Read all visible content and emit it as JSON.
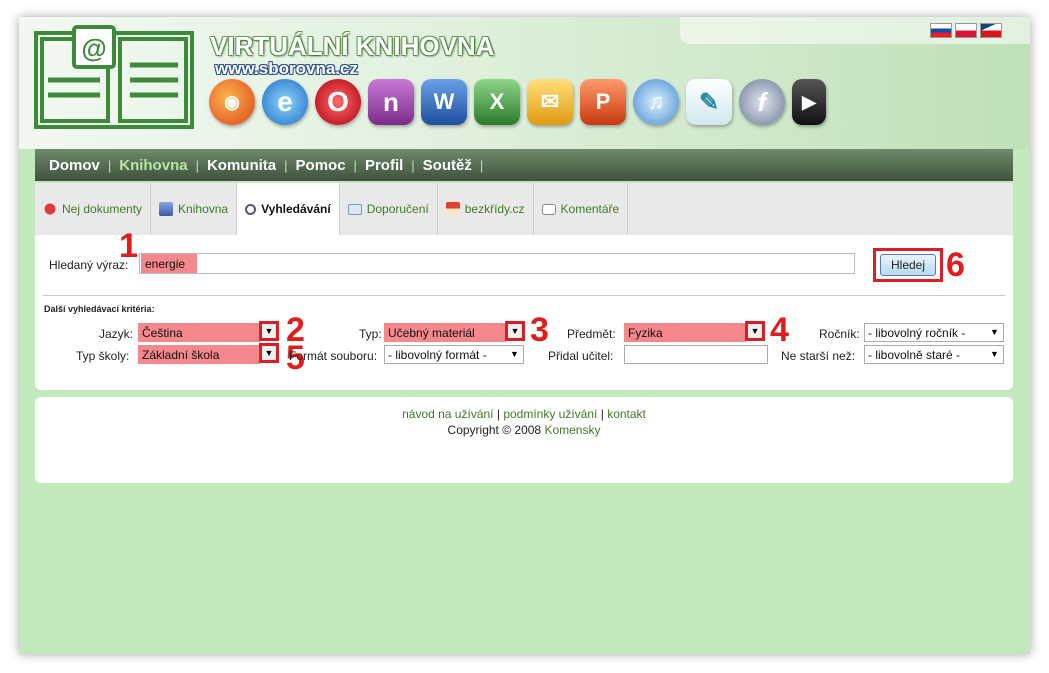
{
  "header": {
    "title": "VIRTUÁLNÍ KNIHOVNA",
    "url": "www.sborovna.cz",
    "app_icons": [
      "firefox-icon",
      "ie-icon",
      "opera-icon",
      "onenote-icon",
      "word-icon",
      "excel-icon",
      "outlook-icon",
      "powerpoint-icon",
      "itunes-icon",
      "feather-icon",
      "flash-icon",
      "avi-icon"
    ],
    "flags": [
      "slovak-flag-icon",
      "polish-flag-icon",
      "czech-flag-icon"
    ]
  },
  "nav": {
    "items": [
      "Domov",
      "Knihovna",
      "Komunita",
      "Pomoc",
      "Profil",
      "Soutěž"
    ]
  },
  "tabs": [
    "Nej dokumenty",
    "Knihovna",
    "Vyhledávání",
    "Doporučení",
    "bezkřídy.cz",
    "Komentáře"
  ],
  "search": {
    "label": "Hledaný výraz:",
    "value": "energie",
    "button": "Hledej",
    "criteria_title": "Další vyhledávací kritéria:"
  },
  "filters": {
    "jazyk_label": "Jazyk:",
    "jazyk_value": "Čeština",
    "typ_label": "Typ:",
    "typ_value": "Učebný materiál",
    "predmet_label": "Předmět:",
    "predmet_value": "Fyzika",
    "rocnik_label": "Ročník:",
    "rocnik_value": "- libovolný ročník -",
    "typ_skoly_label": "Typ školy:",
    "typ_skoly_value": "Základní škola",
    "format_label": "Formát souboru:",
    "format_value": "- libovolný formát -",
    "pridal_label": "Přidal učitel:",
    "pridal_value": "",
    "starsi_label": "Ne starší než:",
    "starsi_value": "- libovolně staré -"
  },
  "annotations": [
    "1",
    "2",
    "3",
    "4",
    "5",
    "6"
  ],
  "footer": {
    "link1": "návod na užívání",
    "sep": "|",
    "link2": "podmínky užívání",
    "link3": "kontakt",
    "copyright": "Copyright © 2008",
    "company": "Komensky"
  },
  "colors": {
    "accent": "#3d7b28",
    "highlight": "#f5888c",
    "annotation": "#e01d1d",
    "background": "#c3e8bb"
  }
}
